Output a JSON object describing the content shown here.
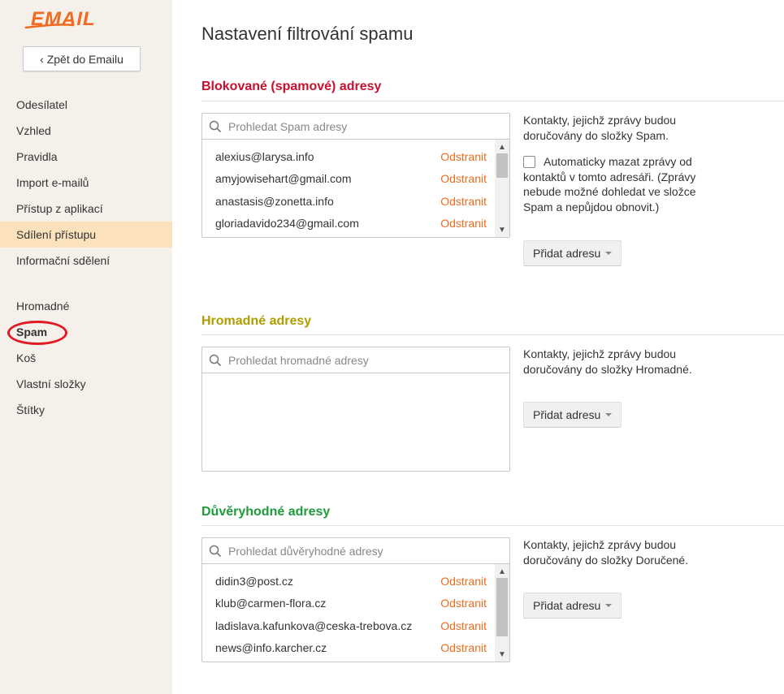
{
  "sidebar": {
    "logo_text": "EMAIL",
    "back_label": "‹ Zpět do Emailu",
    "group1": [
      {
        "label": "Odesílatel"
      },
      {
        "label": "Vzhled"
      },
      {
        "label": "Pravidla"
      },
      {
        "label": "Import e-mailů"
      },
      {
        "label": "Přístup z aplikací"
      },
      {
        "label": "Sdílení přístupu",
        "active": true
      },
      {
        "label": "Informační sdělení"
      }
    ],
    "group2": [
      {
        "label": "Hromadné"
      },
      {
        "label": "Spam",
        "highlighted": true
      },
      {
        "label": "Koš"
      },
      {
        "label": "Vlastní složky"
      },
      {
        "label": "Štítky"
      }
    ]
  },
  "main": {
    "title": "Nastavení filtrování spamu",
    "remove_label": "Odstranit",
    "add_label": "Přidat adresu",
    "blocked": {
      "title": "Blokované (spamové) adresy",
      "search_placeholder": "Prohledat Spam adresy",
      "addresses": [
        "alexius@larysa.info",
        "amyjowisehart@gmail.com",
        "anastasis@zonetta.info",
        "gloriadavido234@gmail.com"
      ],
      "description": "Kontakty, jejichž zprávy budou doručovány do složky Spam.",
      "auto_delete_label": "Automaticky mazat zprávy od kontaktů v tomto adresáři. (Zprávy nebude možné dohledat ve složce Spam a nepůjdou obnovit.)",
      "auto_delete_checked": false
    },
    "bulk": {
      "title": "Hromadné adresy",
      "search_placeholder": "Prohledat hromadné adresy",
      "addresses": [],
      "description": "Kontakty, jejichž zprávy budou doručovány do složky Hromadné."
    },
    "trusted": {
      "title": "Důvěryhodné adresy",
      "search_placeholder": "Prohledat důvěryhodné adresy",
      "addresses": [
        "didin3@post.cz",
        "klub@carmen-flora.cz",
        "ladislava.kafunkova@ceska-trebova.cz",
        "news@info.karcher.cz"
      ],
      "description": "Kontakty, jejichž zprávy budou doručovány do složky Doručené."
    }
  },
  "colors": {
    "blocked_title": "#c8102e",
    "bulk_title": "#b19d00",
    "trusted_title": "#1e9a3c",
    "remove_link": "#f06b1f",
    "active_nav": "#fbe2bd",
    "sidebar_bg": "#f6f0eb",
    "logo": "#f06b1f"
  }
}
